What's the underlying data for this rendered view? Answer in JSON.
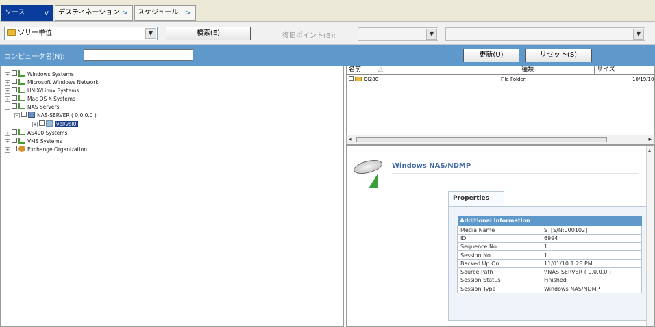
{
  "tabs": [
    {
      "label": "ソース",
      "chevron": "v",
      "active": true
    },
    {
      "label": "デスティネーション",
      "chevron": ">",
      "active": false
    },
    {
      "label": "スケジュール",
      "chevron": ">",
      "active": false
    }
  ],
  "toolbar": {
    "view_select": "ツリー単位",
    "search_button": "検索(E)",
    "restore_point_label": "復旧ポイント(B):"
  },
  "filter": {
    "computer_name_label": "コンピュータ名(N):",
    "computer_name_value": "",
    "refresh_button": "更新(U)",
    "reset_button": "リセット(S)"
  },
  "tree": {
    "nodes": [
      {
        "label": "Windows Systems",
        "expander": "+"
      },
      {
        "label": "Microsoft Windows Network",
        "expander": "+"
      },
      {
        "label": "UNIX/Linux Systems",
        "expander": "+"
      },
      {
        "label": "Mac OS X Systems",
        "expander": "+"
      },
      {
        "label": "NAS Servers",
        "expander": "-"
      },
      {
        "label": "NAS-SERVER ( 0.0.0.0 )",
        "expander": "-"
      },
      {
        "label": "vol/vol0",
        "expander": "+"
      },
      {
        "label": "AS400 Systems",
        "expander": "+"
      },
      {
        "label": "VMS Systems",
        "expander": "+"
      },
      {
        "label": "Exchange Organization",
        "expander": "+"
      }
    ]
  },
  "file_list": {
    "columns": [
      "名前",
      "種類",
      "サイズ"
    ],
    "rows": [
      {
        "name": "QI280",
        "type": "File Folder",
        "date": "10/19/10"
      }
    ]
  },
  "details": {
    "title": "Windows NAS/NDMP",
    "properties_tab": "Properties",
    "table_header": "Additional Information",
    "rows": [
      {
        "key": "Media Name",
        "value": "ST[S/N:000102]"
      },
      {
        "key": "ID",
        "value": "6994"
      },
      {
        "key": "Sequence No.",
        "value": "1"
      },
      {
        "key": "Session No.",
        "value": "1"
      },
      {
        "key": "Backed Up On",
        "value": "11/01/10 1:28 PM"
      },
      {
        "key": "Source Path",
        "value": "\\\\NAS-SERVER ( 0.0.0.0 )"
      },
      {
        "key": "Session Status",
        "value": "Finished"
      },
      {
        "key": "Session Type",
        "value": "Windows NAS/NDMP"
      }
    ]
  },
  "colors": {
    "active_tab": "#0a3d9b",
    "filter_bar": "#5f98cb",
    "title_text": "#4069a6",
    "status_arrow": "#3c9d3c"
  }
}
